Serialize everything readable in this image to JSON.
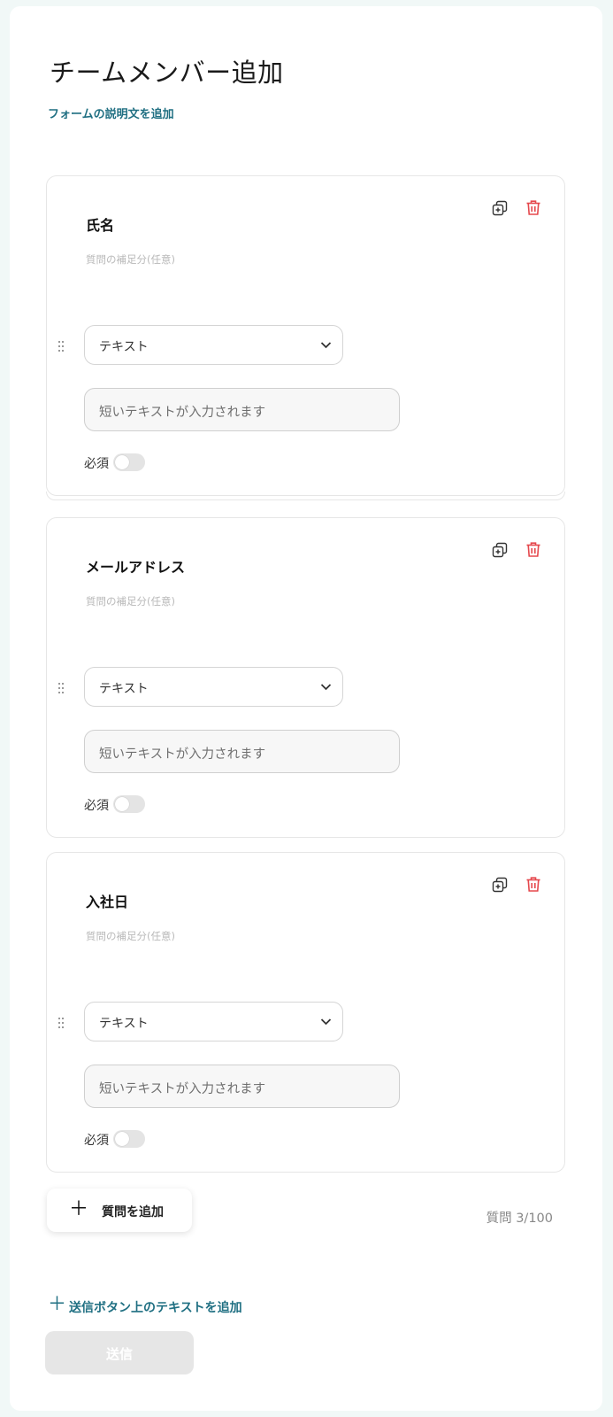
{
  "form": {
    "title": "チームメンバー追加",
    "description_link": "フォームの説明文を追加"
  },
  "questions": [
    {
      "title": "氏名",
      "subtitle": "質問の補足分(任意)",
      "type_label": "テキスト",
      "answer_placeholder": "短いテキストが入力されます",
      "required_label": "必須",
      "required": false
    },
    {
      "title": "メールアドレス",
      "subtitle": "質問の補足分(任意)",
      "type_label": "テキスト",
      "answer_placeholder": "短いテキストが入力されます",
      "required_label": "必須",
      "required": false
    },
    {
      "title": "入社日",
      "subtitle": "質問の補足分(任意)",
      "type_label": "テキスト",
      "answer_placeholder": "短いテキストが入力されます",
      "required_label": "必須",
      "required": false
    }
  ],
  "add_question": {
    "label": "質問を追加",
    "icon": "plus-icon"
  },
  "question_count": "質問 3/100",
  "add_submit_text": {
    "label": "送信ボタン上のテキストを追加",
    "icon": "plus-icon"
  },
  "submit": {
    "label": "送信",
    "disabled": true
  },
  "colors": {
    "accent": "#1f6f82",
    "delete": "#e5484d",
    "background": "#f1f8f7",
    "submit_disabled": "#e6e6e6"
  },
  "icons": [
    "duplicate-icon",
    "trash-icon",
    "drag-handle-icon",
    "chevron-down-icon"
  ]
}
